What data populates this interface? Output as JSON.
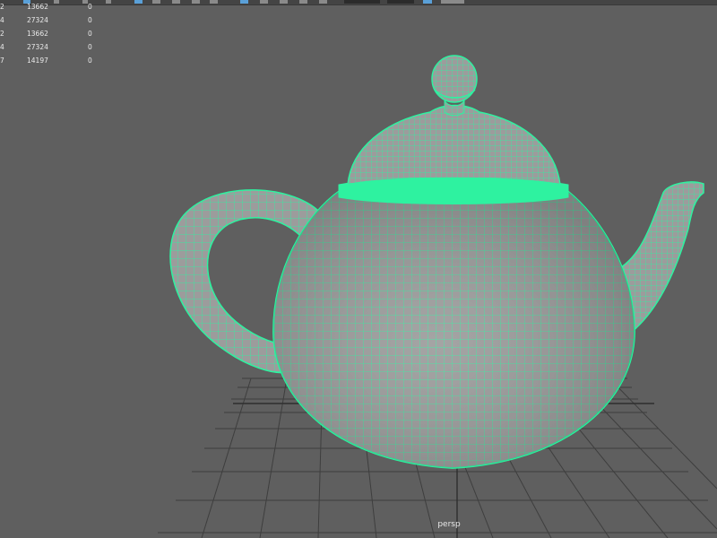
{
  "hud": {
    "rows": [
      {
        "label": "2",
        "value": "13662",
        "extra": "0"
      },
      {
        "label": "4",
        "value": "27324",
        "extra": "0"
      },
      {
        "label": "2",
        "value": "13662",
        "extra": "0"
      },
      {
        "label": "4",
        "value": "27324",
        "extra": "0"
      },
      {
        "label": "7",
        "value": "14197",
        "extra": "0"
      }
    ]
  },
  "viewport": {
    "camera_label": "persp",
    "background_color": "#5f5f5f",
    "wireframe_color": "#2ef2a0",
    "grid_color": "#3e3e3e"
  },
  "scene": {
    "object": "teapot-wireframe-mesh"
  }
}
